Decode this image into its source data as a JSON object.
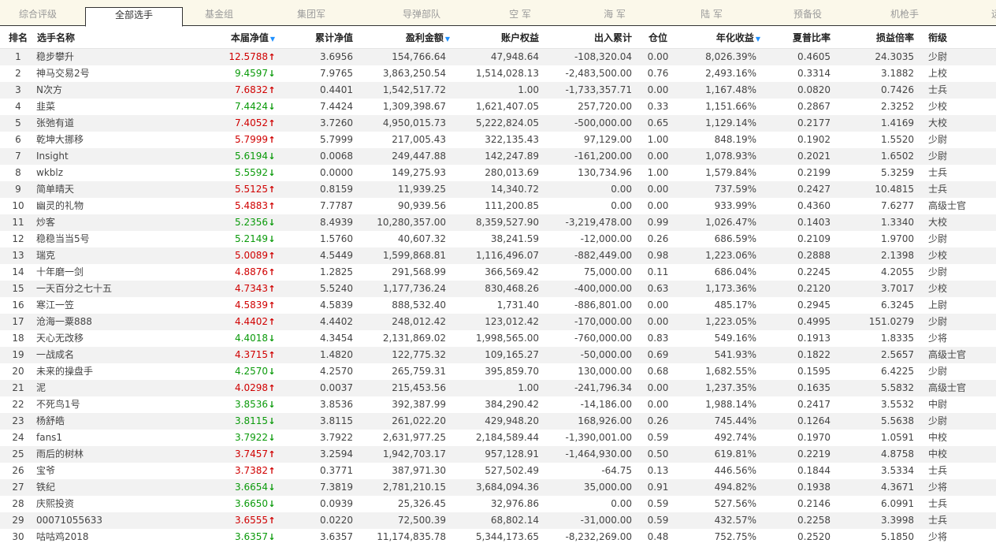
{
  "tabs": [
    "综合评级",
    "全部选手",
    "基金组",
    "集团军",
    "导弹部队",
    "空 军",
    "海 军",
    "陆 军",
    "预备役",
    "机枪手",
    "远程"
  ],
  "active_tab": 1,
  "columns": {
    "rank": "排名",
    "name": "选手名称",
    "nav": "本届净值",
    "cum_nav": "累计净值",
    "profit": "盈利金额",
    "equity": "账户权益",
    "inout": "出入累计",
    "position": "仓位",
    "annual": "年化收益",
    "sharpe": "夏普比率",
    "pl_ratio": "损益倍率",
    "rank_title": "衔级"
  },
  "sorted_columns": [
    "nav",
    "profit",
    "annual"
  ],
  "colors": {
    "up": "#d00000",
    "down": "#0a9a0a",
    "sort_icon": "#1e90ff"
  },
  "rows": [
    {
      "rank": "1",
      "name": "稳步攀升",
      "nav": "12.5788",
      "trend": "up",
      "cum_nav": "3.6956",
      "profit": "154,766.64",
      "equity": "47,948.64",
      "inout": "-108,320.04",
      "position": "0.00",
      "annual": "8,026.39%",
      "sharpe": "0.4605",
      "pl_ratio": "24.3035",
      "title": "少尉"
    },
    {
      "rank": "2",
      "name": "神马交易2号",
      "nav": "9.4597",
      "trend": "down",
      "cum_nav": "7.9765",
      "profit": "3,863,250.54",
      "equity": "1,514,028.13",
      "inout": "-2,483,500.00",
      "position": "0.76",
      "annual": "2,493.16%",
      "sharpe": "0.3314",
      "pl_ratio": "3.1882",
      "title": "上校"
    },
    {
      "rank": "3",
      "name": "N次方",
      "nav": "7.6832",
      "trend": "up",
      "cum_nav": "0.4401",
      "profit": "1,542,517.72",
      "equity": "1.00",
      "inout": "-1,733,357.71",
      "position": "0.00",
      "annual": "1,167.48%",
      "sharpe": "0.0820",
      "pl_ratio": "0.7426",
      "title": "士兵"
    },
    {
      "rank": "4",
      "name": "韭菜",
      "nav": "7.4424",
      "trend": "down",
      "cum_nav": "7.4424",
      "profit": "1,309,398.67",
      "equity": "1,621,407.05",
      "inout": "257,720.00",
      "position": "0.33",
      "annual": "1,151.66%",
      "sharpe": "0.2867",
      "pl_ratio": "2.3252",
      "title": "少校"
    },
    {
      "rank": "5",
      "name": "张弛有道",
      "nav": "7.4052",
      "trend": "up",
      "cum_nav": "3.7260",
      "profit": "4,950,015.73",
      "equity": "5,222,824.05",
      "inout": "-500,000.00",
      "position": "0.65",
      "annual": "1,129.14%",
      "sharpe": "0.2177",
      "pl_ratio": "1.4169",
      "title": "大校"
    },
    {
      "rank": "6",
      "name": "乾坤大挪移",
      "nav": "5.7999",
      "trend": "up",
      "cum_nav": "5.7999",
      "profit": "217,005.43",
      "equity": "322,135.43",
      "inout": "97,129.00",
      "position": "1.00",
      "annual": "848.19%",
      "sharpe": "0.1902",
      "pl_ratio": "1.5520",
      "title": "少尉"
    },
    {
      "rank": "7",
      "name": "Insight",
      "nav": "5.6194",
      "trend": "down",
      "cum_nav": "0.0068",
      "profit": "249,447.88",
      "equity": "142,247.89",
      "inout": "-161,200.00",
      "position": "0.00",
      "annual": "1,078.93%",
      "sharpe": "0.2021",
      "pl_ratio": "1.6502",
      "title": "少尉"
    },
    {
      "rank": "8",
      "name": "wkblz",
      "nav": "5.5592",
      "trend": "down",
      "cum_nav": "0.0000",
      "profit": "149,275.93",
      "equity": "280,013.69",
      "inout": "130,734.96",
      "position": "1.00",
      "annual": "1,579.84%",
      "sharpe": "0.2199",
      "pl_ratio": "5.3259",
      "title": "士兵"
    },
    {
      "rank": "9",
      "name": "简单晴天",
      "nav": "5.5125",
      "trend": "up",
      "cum_nav": "0.8159",
      "profit": "11,939.25",
      "equity": "14,340.72",
      "inout": "0.00",
      "position": "0.00",
      "annual": "737.59%",
      "sharpe": "0.2427",
      "pl_ratio": "10.4815",
      "title": "士兵"
    },
    {
      "rank": "10",
      "name": "幽灵的礼物",
      "nav": "5.4883",
      "trend": "up",
      "cum_nav": "7.7787",
      "profit": "90,939.56",
      "equity": "111,200.85",
      "inout": "0.00",
      "position": "0.00",
      "annual": "933.99%",
      "sharpe": "0.4360",
      "pl_ratio": "7.6277",
      "title": "高级士官"
    },
    {
      "rank": "11",
      "name": "炒客",
      "nav": "5.2356",
      "trend": "down",
      "cum_nav": "8.4939",
      "profit": "10,280,357.00",
      "equity": "8,359,527.90",
      "inout": "-3,219,478.00",
      "position": "0.99",
      "annual": "1,026.47%",
      "sharpe": "0.1403",
      "pl_ratio": "1.3340",
      "title": "大校"
    },
    {
      "rank": "12",
      "name": "稳稳当当5号",
      "nav": "5.2149",
      "trend": "down",
      "cum_nav": "1.5760",
      "profit": "40,607.32",
      "equity": "38,241.59",
      "inout": "-12,000.00",
      "position": "0.26",
      "annual": "686.59%",
      "sharpe": "0.2109",
      "pl_ratio": "1.9700",
      "title": "少尉"
    },
    {
      "rank": "13",
      "name": "瑞克",
      "nav": "5.0089",
      "trend": "up",
      "cum_nav": "4.5449",
      "profit": "1,599,868.81",
      "equity": "1,116,496.07",
      "inout": "-882,449.00",
      "position": "0.98",
      "annual": "1,223.06%",
      "sharpe": "0.2888",
      "pl_ratio": "2.1398",
      "title": "少校"
    },
    {
      "rank": "14",
      "name": "十年磨一剑",
      "nav": "4.8876",
      "trend": "up",
      "cum_nav": "1.2825",
      "profit": "291,568.99",
      "equity": "366,569.42",
      "inout": "75,000.00",
      "position": "0.11",
      "annual": "686.04%",
      "sharpe": "0.2245",
      "pl_ratio": "4.2055",
      "title": "少尉"
    },
    {
      "rank": "15",
      "name": "一天百分之七十五",
      "nav": "4.7343",
      "trend": "up",
      "cum_nav": "5.5240",
      "profit": "1,177,736.24",
      "equity": "830,468.26",
      "inout": "-400,000.00",
      "position": "0.63",
      "annual": "1,173.36%",
      "sharpe": "0.2120",
      "pl_ratio": "3.7017",
      "title": "少校"
    },
    {
      "rank": "16",
      "name": "寒江一笠",
      "nav": "4.5839",
      "trend": "up",
      "cum_nav": "4.5839",
      "profit": "888,532.40",
      "equity": "1,731.40",
      "inout": "-886,801.00",
      "position": "0.00",
      "annual": "485.17%",
      "sharpe": "0.2945",
      "pl_ratio": "6.3245",
      "title": "上尉"
    },
    {
      "rank": "17",
      "name": "沧海一粟888",
      "nav": "4.4402",
      "trend": "up",
      "cum_nav": "4.4402",
      "profit": "248,012.42",
      "equity": "123,012.42",
      "inout": "-170,000.00",
      "position": "0.00",
      "annual": "1,223.05%",
      "sharpe": "0.4995",
      "pl_ratio": "151.0279",
      "title": "少尉"
    },
    {
      "rank": "18",
      "name": "天心无改移",
      "nav": "4.4018",
      "trend": "down",
      "cum_nav": "4.3454",
      "profit": "2,131,869.02",
      "equity": "1,998,565.00",
      "inout": "-760,000.00",
      "position": "0.83",
      "annual": "549.16%",
      "sharpe": "0.1913",
      "pl_ratio": "1.8335",
      "title": "少将"
    },
    {
      "rank": "19",
      "name": "一战成名",
      "nav": "4.3715",
      "trend": "up",
      "cum_nav": "1.4820",
      "profit": "122,775.32",
      "equity": "109,165.27",
      "inout": "-50,000.00",
      "position": "0.69",
      "annual": "541.93%",
      "sharpe": "0.1822",
      "pl_ratio": "2.5657",
      "title": "高级士官"
    },
    {
      "rank": "20",
      "name": "未来的操盘手",
      "nav": "4.2570",
      "trend": "down",
      "cum_nav": "4.2570",
      "profit": "265,759.31",
      "equity": "395,859.70",
      "inout": "130,000.00",
      "position": "0.68",
      "annual": "1,682.55%",
      "sharpe": "0.1595",
      "pl_ratio": "6.4225",
      "title": "少尉"
    },
    {
      "rank": "21",
      "name": "泥",
      "nav": "4.0298",
      "trend": "up",
      "cum_nav": "0.0037",
      "profit": "215,453.56",
      "equity": "1.00",
      "inout": "-241,796.34",
      "position": "0.00",
      "annual": "1,237.35%",
      "sharpe": "0.1635",
      "pl_ratio": "5.5832",
      "title": "高级士官"
    },
    {
      "rank": "22",
      "name": "不死鸟1号",
      "nav": "3.8536",
      "trend": "down",
      "cum_nav": "3.8536",
      "profit": "392,387.99",
      "equity": "384,290.42",
      "inout": "-14,186.00",
      "position": "0.00",
      "annual": "1,988.14%",
      "sharpe": "0.2417",
      "pl_ratio": "3.5532",
      "title": "中尉"
    },
    {
      "rank": "23",
      "name": "杨舒皓",
      "nav": "3.8115",
      "trend": "down",
      "cum_nav": "3.8115",
      "profit": "261,022.20",
      "equity": "429,948.20",
      "inout": "168,926.00",
      "position": "0.26",
      "annual": "745.44%",
      "sharpe": "0.1264",
      "pl_ratio": "5.5638",
      "title": "少尉"
    },
    {
      "rank": "24",
      "name": "fans1",
      "nav": "3.7922",
      "trend": "down",
      "cum_nav": "3.7922",
      "profit": "2,631,977.25",
      "equity": "2,184,589.44",
      "inout": "-1,390,001.00",
      "position": "0.59",
      "annual": "492.74%",
      "sharpe": "0.1970",
      "pl_ratio": "1.0591",
      "title": "中校"
    },
    {
      "rank": "25",
      "name": "雨后的树林",
      "nav": "3.7457",
      "trend": "up",
      "cum_nav": "3.2594",
      "profit": "1,942,703.17",
      "equity": "957,128.91",
      "inout": "-1,464,930.00",
      "position": "0.50",
      "annual": "619.81%",
      "sharpe": "0.2219",
      "pl_ratio": "4.8758",
      "title": "中校"
    },
    {
      "rank": "26",
      "name": "宝爷",
      "nav": "3.7382",
      "trend": "up",
      "cum_nav": "0.3771",
      "profit": "387,971.30",
      "equity": "527,502.49",
      "inout": "-64.75",
      "position": "0.13",
      "annual": "446.56%",
      "sharpe": "0.1844",
      "pl_ratio": "3.5334",
      "title": "士兵"
    },
    {
      "rank": "27",
      "name": "铁纪",
      "nav": "3.6654",
      "trend": "down",
      "cum_nav": "7.3819",
      "profit": "2,781,210.15",
      "equity": "3,684,094.36",
      "inout": "35,000.00",
      "position": "0.91",
      "annual": "494.82%",
      "sharpe": "0.1938",
      "pl_ratio": "4.3671",
      "title": "少将"
    },
    {
      "rank": "28",
      "name": "庆熙投资",
      "nav": "3.6650",
      "trend": "down",
      "cum_nav": "0.0939",
      "profit": "25,326.45",
      "equity": "32,976.86",
      "inout": "0.00",
      "position": "0.59",
      "annual": "527.56%",
      "sharpe": "0.2146",
      "pl_ratio": "6.0991",
      "title": "士兵"
    },
    {
      "rank": "29",
      "name": "00071055633",
      "nav": "3.6555",
      "trend": "up",
      "cum_nav": "0.0220",
      "profit": "72,500.39",
      "equity": "68,802.14",
      "inout": "-31,000.00",
      "position": "0.59",
      "annual": "432.57%",
      "sharpe": "0.2258",
      "pl_ratio": "3.3998",
      "title": "士兵"
    },
    {
      "rank": "30",
      "name": "咕咕鸡2018",
      "nav": "3.6357",
      "trend": "down",
      "cum_nav": "3.6357",
      "profit": "11,174,835.78",
      "equity": "5,344,173.65",
      "inout": "-8,232,269.00",
      "position": "0.48",
      "annual": "752.75%",
      "sharpe": "0.2520",
      "pl_ratio": "5.1850",
      "title": "少将"
    }
  ]
}
